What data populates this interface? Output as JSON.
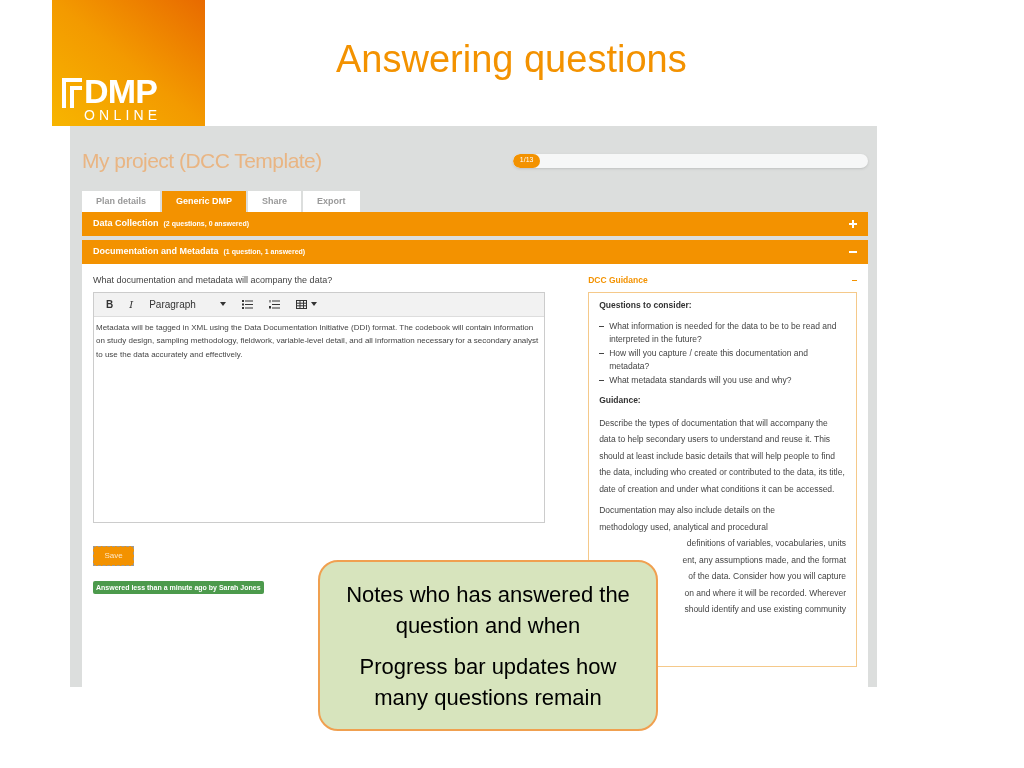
{
  "slide": {
    "title": "Answering questions",
    "logo": {
      "main": "DMP",
      "sub": "ONLINE"
    }
  },
  "app": {
    "project_title": "My project (DCC Template)",
    "progress": {
      "label": "1/13",
      "level": 0.077
    },
    "tabs": [
      {
        "label": "Plan details",
        "selected": false
      },
      {
        "label": "Generic DMP",
        "selected": true
      },
      {
        "label": "Share",
        "selected": false
      },
      {
        "label": "Export",
        "selected": false
      }
    ],
    "sections": [
      {
        "title": "Data Collection",
        "meta": "(2 questions, 0 answered)",
        "expanded": false
      },
      {
        "title": "Documentation and Metadata",
        "meta": "(1 question, 1 answered)",
        "expanded": true
      }
    ],
    "question": "What documentation and metadata will acompany the data?",
    "toolbar": [
      {
        "kind": "bold",
        "label": "B"
      },
      {
        "kind": "italic",
        "label": "I"
      },
      {
        "kind": "select",
        "label": "Paragraph"
      },
      {
        "kind": "bullets"
      },
      {
        "kind": "numbers"
      },
      {
        "kind": "table"
      }
    ],
    "answer": "Metadata will be tagged in XML using the Data Documentation Initiative (DDI) format. The codebook will contain information on study design, sampling methodology, fieldwork, variable-level detail, and all information necessary for a secondary analyst to use the data accurately and effectively.",
    "save_button": "Save",
    "answered_badge": "Answered less than a minute ago by Sarah Jones",
    "guidance": {
      "title": "DCC Guidance",
      "expanded": true,
      "questions_heading": "Questions to consider:",
      "questions": [
        "What information is needed for the data to be to be read and interpreted in the future?",
        "How will you capture / create this documentation and metadata?",
        "What metadata standards will you use and why?"
      ],
      "guidance_heading": "Guidance:",
      "paragraph": "Describe the types of documentation that will accompany the data to help secondary users to understand and reuse it. This should at least include basic details that will help people to find the data, including who created or contributed to the data, its title, date of creation and under what conditions it can be accessed.",
      "partial_lines": [
        "Documentation may also include details on the",
        "methodology used, analytical and procedural",
        "definitions of variables, vocabularies, units",
        "ent, any assumptions made, and the format",
        "of the data. Consider how you will capture",
        "on and where it will be recorded. Wherever",
        "should identify and use existing community"
      ]
    }
  },
  "callout": {
    "paragraphs": [
      "Notes who has answered the question and when",
      "Progress bar updates how many questions remain"
    ]
  }
}
